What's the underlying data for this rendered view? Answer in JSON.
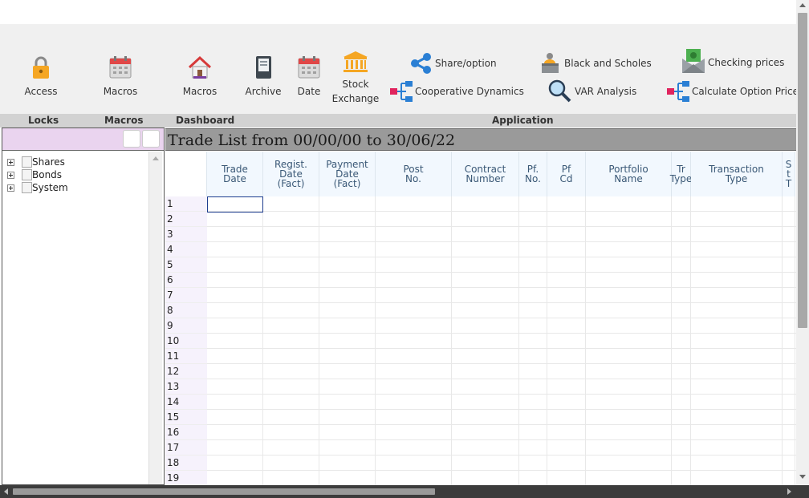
{
  "ribbon": {
    "access": {
      "label": "Access"
    },
    "macros1": {
      "label": "Macros"
    },
    "macros2": {
      "label": "Macros"
    },
    "archive": {
      "label": "Archive"
    },
    "date": {
      "label": "Date"
    },
    "stock_exchange": {
      "label_line1": "Stock",
      "label_line2": "Exchange"
    },
    "share_option": {
      "label": "Share/option"
    },
    "cooperative_dynamics": {
      "label": "Cooperative Dynamics"
    },
    "black_scholes": {
      "label": "Black and Scholes"
    },
    "var_analysis": {
      "label": "VAR Analysis"
    },
    "checking_prices": {
      "label": "Checking prices"
    },
    "calculate_option_prices": {
      "label": "Calculate Option Prices"
    }
  },
  "groups": {
    "locks": "Locks",
    "macros": "Macros",
    "dashboard": "Dashboard",
    "application": "Application"
  },
  "tree": {
    "items": [
      {
        "label": "Shares"
      },
      {
        "label": "Bonds"
      },
      {
        "label": "System"
      }
    ]
  },
  "panel": {
    "title": "Trade List from 00/00/00 to 30/06/22"
  },
  "table": {
    "columns": [
      "Trade\nDate",
      "Regist.\nDate\n(Fact)",
      "Payment\nDate\n(Fact)",
      "Post\nNo.",
      "Contract\nNumber",
      "Pf.\nNo.",
      "Pf\nCd",
      "Portfolio\nName",
      "Tr\nType",
      "Transaction\nType",
      "S\nt\nT"
    ],
    "rows": [
      "1",
      "2",
      "3",
      "4",
      "5",
      "6",
      "7",
      "8",
      "9",
      "10",
      "11",
      "12",
      "13",
      "14",
      "15",
      "16",
      "17",
      "18",
      "19"
    ]
  },
  "colors": {
    "ribbon_bg": "#f0f0f0",
    "group_bar": "#d2d2d2",
    "left_header": "#ead4ef",
    "title_bar": "#9a9a9a",
    "header_bg": "#f2f8fe",
    "header_text": "#3a5876",
    "row_header_bg": "#f6f2fc",
    "accent_blue": "#2a7fd4",
    "accent_pink": "#e0245e",
    "lock_orange": "#f5a623"
  },
  "icons": {
    "access": "lock-icon",
    "macros1": "calendar-icon",
    "macros2": "house-icon",
    "archive": "book-icon",
    "date": "calendar-icon",
    "stock_exchange": "bank-icon",
    "share_option": "share-icon",
    "cooperative_dynamics": "network-icon",
    "black_scholes": "teacher-icon",
    "var_analysis": "magnifier-icon",
    "checking_prices": "money-envelope-icon",
    "calculate_option_prices": "network-icon"
  }
}
